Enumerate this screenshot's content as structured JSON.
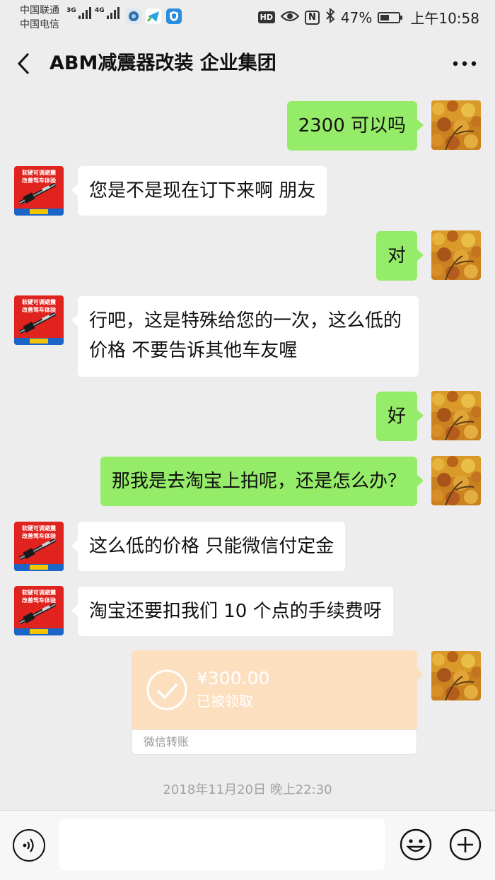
{
  "status_bar": {
    "carrier_1": "中国联通",
    "carrier_2": "中国电信",
    "network_1": "3G",
    "network_2": "4G",
    "hd": "HD",
    "nfc": "N",
    "battery_percent": "47%",
    "battery_level": 0.47,
    "time": "上午10:58"
  },
  "header": {
    "title": "ABM减震器改装 企业集团"
  },
  "avatar_text": {
    "line1": "软硬可调避震",
    "line2": "改善驾车体验",
    "line3": "私人定制",
    "line4": "专业专用"
  },
  "messages": [
    {
      "side": "right",
      "text": "2300 可以吗"
    },
    {
      "side": "left",
      "text": "您是不是现在订下来啊 朋友"
    },
    {
      "side": "right",
      "text": "对"
    },
    {
      "side": "left",
      "text": "行吧，这是特殊给您的一次，这么低的价格 不要告诉其他车友喔"
    },
    {
      "side": "right",
      "text": "好"
    },
    {
      "side": "right",
      "text": "那我是去淘宝上拍呢，还是怎么办？"
    },
    {
      "side": "left",
      "text": "这么低的价格 只能微信付定金"
    },
    {
      "side": "left",
      "text": "淘宝还要扣我们 10 个点的手续费呀"
    }
  ],
  "transfer": {
    "amount": "¥300.00",
    "status": "已被领取",
    "label": "微信转账"
  },
  "timestamp": "2018年11月20日 晚上22:30",
  "input": {
    "value": "",
    "placeholder": ""
  },
  "colors": {
    "bg": "#ededed",
    "bubble_sent": "#95ec69",
    "bubble_received": "#ffffff",
    "transfer": "#fcdfbf",
    "avatar_brand": "#e0231f"
  }
}
